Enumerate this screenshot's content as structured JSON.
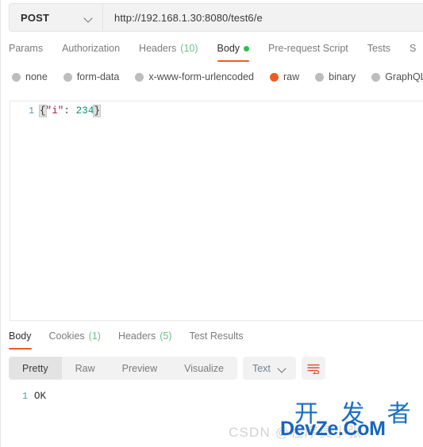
{
  "request": {
    "method": "POST",
    "method_chevron_icon": "chevron-down-icon",
    "url": "http://192.168.1.30:8080/test6/e",
    "tabs": [
      {
        "label": "Params",
        "count": "",
        "active": false,
        "dot": false
      },
      {
        "label": "Authorization",
        "count": "",
        "active": false,
        "dot": false
      },
      {
        "label": "Headers",
        "count": "(10)",
        "active": false,
        "dot": false
      },
      {
        "label": "Body",
        "count": "",
        "active": true,
        "dot": true
      },
      {
        "label": "Pre-request Script",
        "count": "",
        "active": false,
        "dot": false
      },
      {
        "label": "Tests",
        "count": "",
        "active": false,
        "dot": false
      },
      {
        "label": "S",
        "count": "",
        "active": false,
        "dot": false
      }
    ],
    "body_types": [
      {
        "label": "none",
        "selected": false
      },
      {
        "label": "form-data",
        "selected": false
      },
      {
        "label": "x-www-form-urlencoded",
        "selected": false
      },
      {
        "label": "raw",
        "selected": true
      },
      {
        "label": "binary",
        "selected": false
      },
      {
        "label": "GraphQL",
        "selected": false
      }
    ],
    "editor": {
      "line_number": "1",
      "tokens": {
        "open_brace": "{",
        "key": "\"i\"",
        "colon": ":",
        "space": " ",
        "number": "234",
        "close_brace": "}"
      },
      "raw_text": "{\"i\": 234}"
    }
  },
  "response": {
    "tabs": [
      {
        "label": "Body",
        "count": "",
        "active": true
      },
      {
        "label": "Cookies",
        "count": "(1)",
        "active": false
      },
      {
        "label": "Headers",
        "count": "(5)",
        "active": false
      },
      {
        "label": "Test Results",
        "count": "",
        "active": false
      }
    ],
    "view_modes": [
      {
        "label": "Pretty",
        "active": true
      },
      {
        "label": "Raw",
        "active": false
      },
      {
        "label": "Preview",
        "active": false
      },
      {
        "label": "Visualize",
        "active": false
      }
    ],
    "content_type": {
      "label": "Text",
      "chevron_icon": "chevron-down-icon"
    },
    "wrap_icon": "word-wrap-icon",
    "body": {
      "line_number": "1",
      "text": "OK"
    }
  },
  "watermarks": {
    "csdn": "CSDN @程序员小张",
    "devze_cn": "开 发 者",
    "devze_en": "DevZe.CoM"
  },
  "colors": {
    "accent_orange": "#ef5b25",
    "status_green": "#2fbf4f",
    "count_green": "#6ec08a",
    "watermark_blue": "#1565c0",
    "json_key": "#a11843",
    "json_number": "#108f72"
  }
}
